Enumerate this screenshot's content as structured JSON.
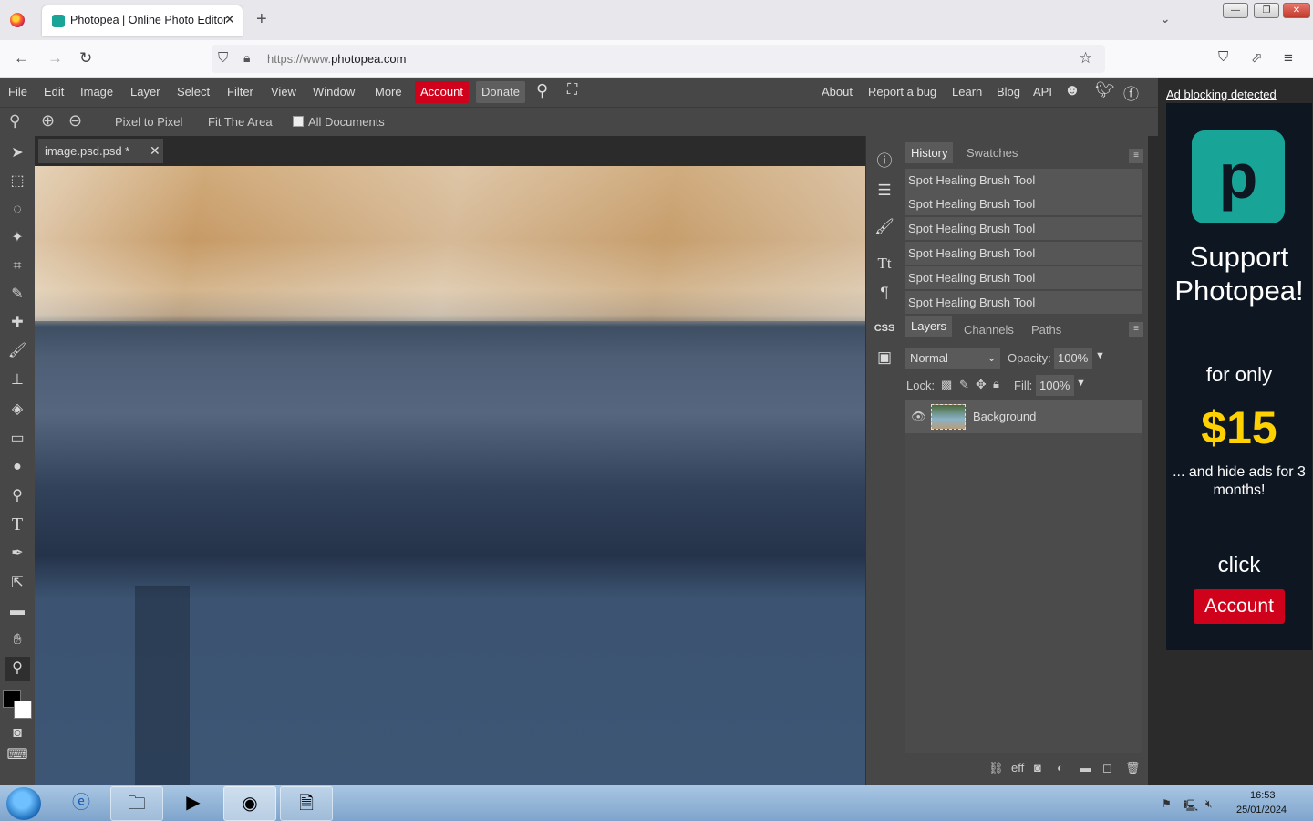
{
  "browser": {
    "tab_title": "Photopea | Online Photo Editor",
    "tab_close": "✕",
    "new_tab": "+",
    "url_prefix": "https://www.",
    "url_domain": "photopea.com"
  },
  "menubar": {
    "items": [
      "File",
      "Edit",
      "Image",
      "Layer",
      "Select",
      "Filter",
      "View",
      "Window",
      "More"
    ],
    "account": "Account",
    "donate": "Donate",
    "right_links": [
      "About",
      "Report a bug",
      "Learn",
      "Blog",
      "API"
    ]
  },
  "options": {
    "pixel_to_pixel": "Pixel to Pixel",
    "fit_area": "Fit The Area",
    "all_documents": "All Documents"
  },
  "document": {
    "tab_name": "image.psd.psd *",
    "close": "✕"
  },
  "history_panel": {
    "tabs": [
      "History",
      "Swatches"
    ],
    "items": [
      "Spot Healing Brush Tool",
      "Spot Healing Brush Tool",
      "Spot Healing Brush Tool",
      "Spot Healing Brush Tool",
      "Spot Healing Brush Tool",
      "Spot Healing Brush Tool"
    ]
  },
  "layers_panel": {
    "tabs": [
      "Layers",
      "Channels",
      "Paths"
    ],
    "blend_mode": "Normal",
    "opacity_label": "Opacity:",
    "opacity_value": "100%",
    "lock_label": "Lock:",
    "fill_label": "Fill:",
    "fill_value": "100%",
    "layers": [
      {
        "name": "Background"
      }
    ],
    "footer_eff": "eff"
  },
  "ad": {
    "notice": "Ad blocking detected",
    "title": "Support Photopea!",
    "for_only": "for only",
    "price": "$15",
    "sub": "... and hide ads for 3 months!",
    "click": "click",
    "account_button": "Account"
  },
  "side_icons": {
    "css": "CSS"
  },
  "taskbar": {
    "time": "16:53",
    "date": "25/01/2024"
  },
  "colors": {
    "accent_red": "#d0021b",
    "photopea_teal": "#18a497",
    "price_yellow": "#ffd100",
    "panel_bg": "#474747"
  }
}
